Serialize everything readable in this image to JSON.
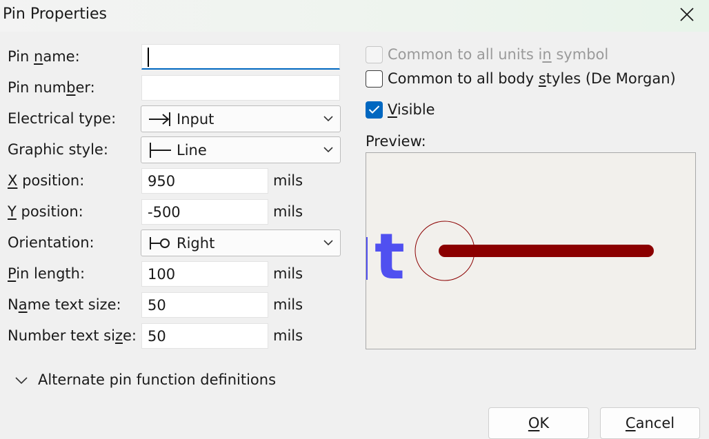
{
  "window": {
    "title": "Pin Properties"
  },
  "form": {
    "pin_name": {
      "label": "Pin name:",
      "value": ""
    },
    "pin_number": {
      "label": "Pin number:",
      "value": ""
    },
    "electrical_type": {
      "label": "Electrical type:",
      "value": "Input",
      "icon": "input-pin-arrow-icon"
    },
    "graphic_style": {
      "label": "Graphic style:",
      "value": "Line",
      "icon": "line-style-icon"
    },
    "x_position": {
      "label": "X position:",
      "value": "950",
      "unit": "mils"
    },
    "y_position": {
      "label": "Y position:",
      "value": "-500",
      "unit": "mils"
    },
    "orientation": {
      "label": "Orientation:",
      "value": "Right",
      "icon": "orientation-right-icon"
    },
    "pin_length": {
      "label": "Pin length:",
      "value": "100",
      "unit": "mils"
    },
    "name_text_size": {
      "label": "Name text size:",
      "value": "50",
      "unit": "mils"
    },
    "number_text_size": {
      "label": "Number text size:",
      "value": "50",
      "unit": "mils"
    }
  },
  "options": {
    "common_units": {
      "label": "Common to all units in symbol",
      "checked": false,
      "disabled": true
    },
    "common_body_styles": {
      "label": "Common to all body styles (De Morgan)",
      "checked": false,
      "disabled": false
    },
    "visible": {
      "label": "Visible",
      "checked": true
    }
  },
  "preview": {
    "label": "Preview:",
    "glyph": "t",
    "pin_color": "#8b0000",
    "text_color": "#5050f0"
  },
  "alternate": {
    "label": "Alternate pin function definitions",
    "expanded": false
  },
  "buttons": {
    "ok": "OK",
    "cancel": "Cancel"
  },
  "colors": {
    "accent": "#0067c0",
    "background": "#f0f0f0"
  }
}
